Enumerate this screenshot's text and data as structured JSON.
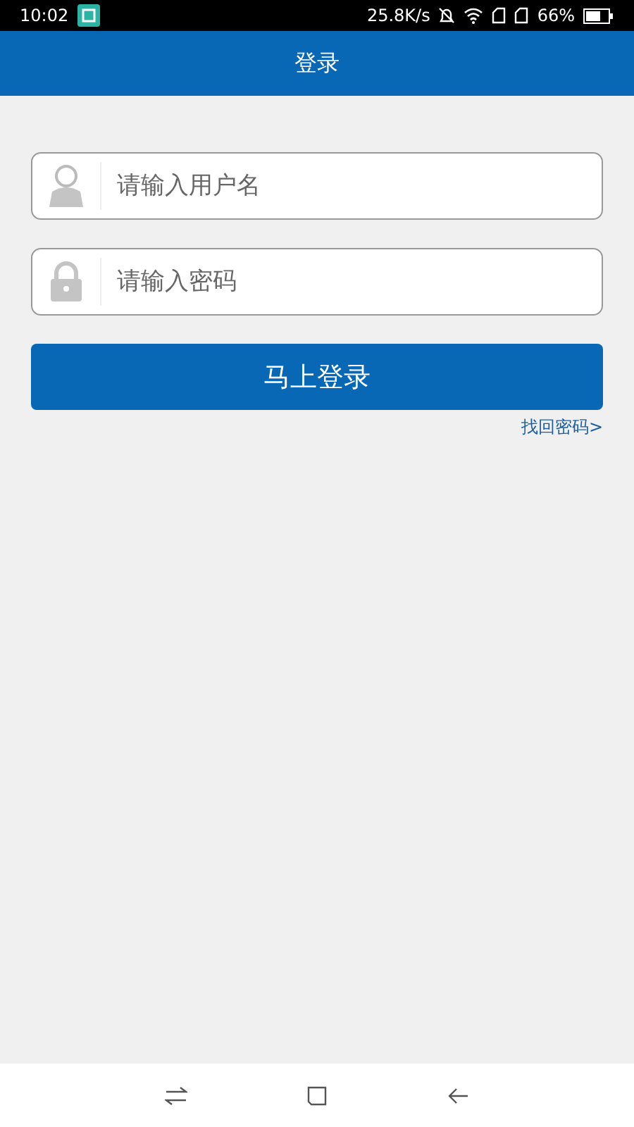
{
  "status_bar": {
    "time": "10:02",
    "speed": "25.8K/s",
    "battery": "66%"
  },
  "header": {
    "title": "登录"
  },
  "fields": [
    {
      "kind": "user",
      "placeholder": "请输入用户名"
    },
    {
      "kind": "password",
      "placeholder": "请输入密码"
    }
  ],
  "login_button": "马上登录",
  "forgot_link": "找回密码>"
}
